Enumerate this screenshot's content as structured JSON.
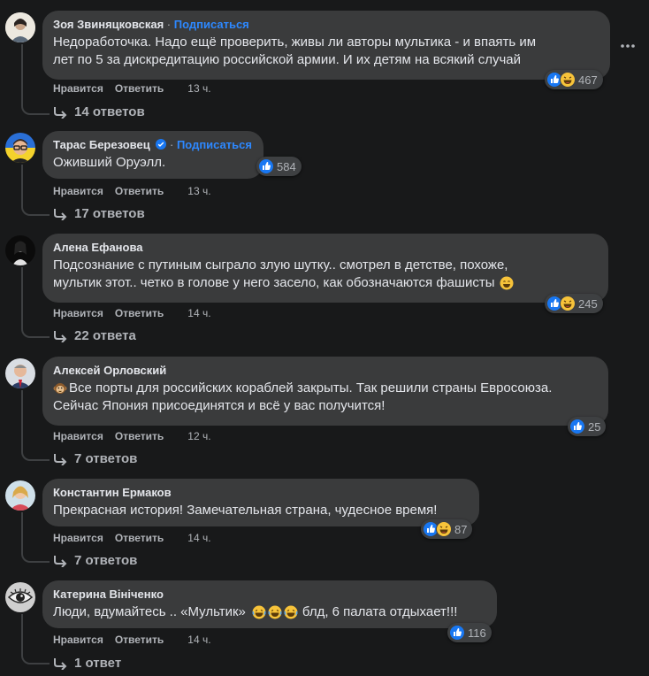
{
  "colors": {
    "background": "#18191a",
    "bubble": "#3a3b3c",
    "link": "#2d88ff",
    "muted": "#b0b3b8",
    "like": "#1877f2"
  },
  "actions": {
    "like_label": "Нравится",
    "reply_label": "Ответить"
  },
  "comments": [
    {
      "author": "Зоя Звиняцковская",
      "subscribe_label": "Подписаться",
      "text_lines": [
        "Недоработочка. Надо ещё проверить, живы ли авторы мультика - и впаять им",
        "лет по 5 за дискредитацию российской армии. И их детям на всякий случай"
      ],
      "reaction_count": "467",
      "reactions": [
        "like-icon",
        "haha-icon"
      ],
      "time": "13 ч.",
      "replies": "14 ответов"
    },
    {
      "author": "Тарас Березовец",
      "verified": true,
      "subscribe_label": "Подписаться",
      "text_lines": [
        "Оживший Оруэлл."
      ],
      "reaction_count": "584",
      "reactions": [
        "like-icon"
      ],
      "time": "13 ч.",
      "replies": "17 ответов"
    },
    {
      "author": "Алена Ефанова",
      "text_lines": [
        "Подсознание с путиным сыграло злую шутку.. смотрел в детстве, похоже,",
        "мультик этот.. четко в голове у него засело, как обозначаются фашисты"
      ],
      "emoji": "smile-emoji-icon",
      "reaction_count": "245",
      "reactions": [
        "like-icon",
        "haha-icon"
      ],
      "time": "14 ч.",
      "replies": "22 ответа"
    },
    {
      "author": "Алексей Орловский",
      "emoji_prefix": "monkey-emoji-icon",
      "text_lines": [
        "Все порты для российских кораблей закрыты. Так решили страны Евросоюза.",
        "Сейчас Япония присоединятся и всё у вас получится!"
      ],
      "reaction_count": "25",
      "reactions": [
        "like-icon"
      ],
      "time": "12 ч.",
      "replies": "7 ответов"
    },
    {
      "author": "Константин Ермаков",
      "text_lines": [
        "Прекрасная история! Замечательная страна, чудесное время!"
      ],
      "reaction_count": "87",
      "reactions": [
        "like-icon",
        "haha-icon"
      ],
      "time": "14 ч.",
      "replies": "7 ответов"
    },
    {
      "author": "Катерина Вініченко",
      "text_lines": [
        "Люди, вдумайтесь .. «Мультик»",
        "блд, 6 палата отдыхает!!!"
      ],
      "reaction_count": "116",
      "reactions": [
        "like-icon"
      ],
      "time": "14 ч.",
      "replies": "1 ответ"
    }
  ]
}
